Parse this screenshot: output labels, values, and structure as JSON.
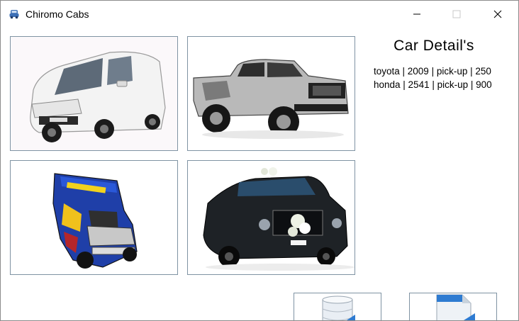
{
  "window": {
    "title": "Chiromo Cabs",
    "app_icon": "car-icon",
    "controls": [
      "minimize-icon",
      "maximize-icon",
      "close-icon"
    ]
  },
  "gallery": {
    "images": [
      {
        "name": "white-van-image",
        "subject": "white compact van"
      },
      {
        "name": "pickup-truck-image",
        "subject": "silver pickup truck"
      },
      {
        "name": "jeepney-image",
        "subject": "blue jeepney"
      },
      {
        "name": "limousine-image",
        "subject": "black wedding limousine"
      }
    ]
  },
  "details": {
    "heading": "Car Detail's",
    "lines": [
      "toyota | 2009 | pick-up | 250",
      "honda | 2541 | pick-up | 900"
    ]
  },
  "actions": [
    {
      "name": "database-button",
      "icon": "database-icon"
    },
    {
      "name": "document-button",
      "icon": "document-icon"
    }
  ],
  "colors": {
    "frame_border": "#7f93a3",
    "window_border": "#8c8c8c",
    "icon_blue": "#2e7bd1"
  }
}
